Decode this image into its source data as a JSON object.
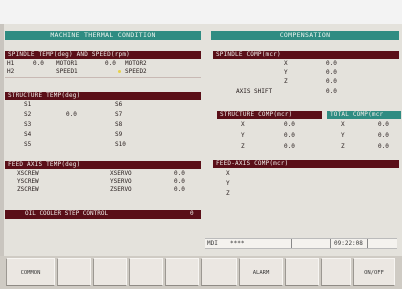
{
  "thermal": {
    "title": "MACHINE THERMAL CONDITION",
    "spindle_header": "SPINDLE TEMP(deg) AND SPEED(rpm)",
    "spindle_rows": [
      {
        "label": "H1",
        "value": "0.0",
        "motor": "MOTOR1",
        "mvalue": "0.0",
        "motor2": "MOTOR2"
      },
      {
        "label": "H2",
        "value": "",
        "motor": "SPEED1",
        "mvalue": "",
        "motor2": "SPEED2"
      }
    ],
    "structure_header": "STRUCTURE TEMP(deg)",
    "structure_rows": [
      {
        "left": "S1",
        "lval": "",
        "right": "S6"
      },
      {
        "left": "S2",
        "lval": "0.0",
        "right": "S7"
      },
      {
        "left": "S3",
        "lval": "",
        "right": "S8"
      },
      {
        "left": "S4",
        "lval": "",
        "right": "S9"
      },
      {
        "left": "S5",
        "lval": "",
        "right": "S10"
      }
    ],
    "feed_header": "FEED AXIS TEMP(deg)",
    "feed_rows": [
      {
        "left": "XSCREW",
        "right": "XSERVO",
        "value": "0.0"
      },
      {
        "left": "YSCREW",
        "right": "YSERVO",
        "value": "0.0"
      },
      {
        "left": "ZSCREW",
        "right": "ZSERVO",
        "value": "0.0"
      }
    ],
    "oil_label": "OIL COOLER STEP CONTROL",
    "oil_value": "0"
  },
  "compensation": {
    "title": "COMPENSATION",
    "spindle_comp_header": "SPINDLE COMP(mcr)",
    "spindle_comp_rows": [
      {
        "axis": "X",
        "value": "0.0"
      },
      {
        "axis": "Y",
        "value": "0.0"
      },
      {
        "axis": "Z",
        "value": "0.0"
      },
      {
        "axis": "AXIS SHIFT",
        "value": "0.0"
      }
    ],
    "structure_comp_header": "STRUCTURE COMP(mcr)",
    "total_comp_header": "TOTAL COMP(mcr",
    "struct_rows": [
      {
        "axis": "X",
        "value": "0.0",
        "taxis": "X",
        "tvalue": "0.0"
      },
      {
        "axis": "Y",
        "value": "0.0",
        "taxis": "Y",
        "tvalue": "0.0"
      },
      {
        "axis": "Z",
        "value": "0.0",
        "taxis": "Z",
        "tvalue": "0.0"
      }
    ],
    "feed_comp_header": "FEED-AXIS COMP(mcr)",
    "feed_comp_rows": [
      "X",
      "Y",
      "Z"
    ]
  },
  "status": {
    "mode": "MDI",
    "stars": "****",
    "time": "09:22:08"
  },
  "softkeys": [
    "COMMON",
    "",
    "",
    "",
    "",
    "",
    "ALARM",
    "",
    "",
    "ON/OFF"
  ],
  "colors": {
    "title_bar": "#2f8c82",
    "section_header": "#5a0f18",
    "highlight": "#2f8c82",
    "indicator": "#e8d24a"
  }
}
